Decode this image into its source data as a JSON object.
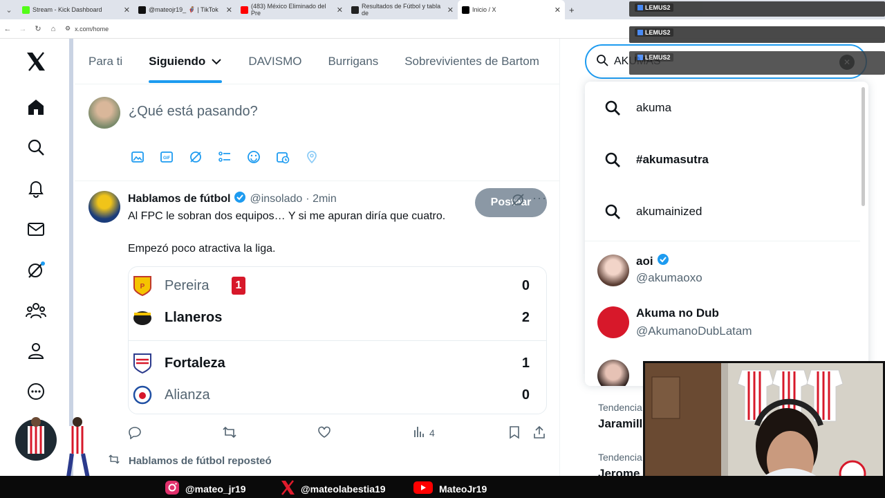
{
  "browser": {
    "tabs": [
      {
        "label": "Stream - Kick Dashboard",
        "color": "#53fc18"
      },
      {
        "label": "@mateojr19_ 🦸 | TikTok",
        "color": "#111111"
      },
      {
        "label": "(483) México Eliminado del Pre",
        "color": "#ff0000"
      },
      {
        "label": "Resultados de Fútbol y tabla de",
        "color": "#222222"
      },
      {
        "label": "Inicio / X",
        "color": "#000000"
      }
    ],
    "url": "x.com/home",
    "new_tab_symbol": "+"
  },
  "overlays": {
    "stream_tags": [
      "LEMUS2",
      "LEMUS2",
      "LEMUS2"
    ]
  },
  "nav": {
    "items": [
      "x-logo",
      "home-icon",
      "search-icon",
      "bell-icon",
      "mail-icon",
      "grok-icon",
      "communities-icon",
      "profile-icon",
      "more-icon"
    ]
  },
  "timeline": {
    "tabs": [
      "Para ti",
      "Siguiendo",
      "DAVISMO",
      "Burrigans",
      "Sobrevivientes de Bartom"
    ],
    "selected_tab": "Siguiendo",
    "compose_placeholder": "¿Qué está pasando?",
    "post_button": "Postear"
  },
  "tweet": {
    "name": "Hablamos de fútbol",
    "handle": "@insolado",
    "time": "· 2min",
    "line1": "Al FPC le sobran dos equipos… Y si me apuran diría que cuatro.",
    "line2": "Empezó poco atractiva la liga.",
    "matches": [
      {
        "home": "Pereira",
        "home_score": "0",
        "home_red_cards": "1",
        "away": "Llaneros",
        "away_score": "2"
      },
      {
        "home": "Fortaleza",
        "home_score": "1",
        "away": "Alianza",
        "away_score": "0"
      }
    ],
    "views": "4"
  },
  "repost": {
    "label": "Hablamos de fútbol reposteó"
  },
  "search": {
    "query": "AKUMAS",
    "suggestions": [
      "akuma",
      "#akumasutra",
      "akumainized"
    ],
    "users": [
      {
        "name": "aoi",
        "handle": "@akumaoxo",
        "verified": true
      },
      {
        "name": "Akuma no Dub",
        "handle": "@AkumanoDubLatam",
        "verified": false
      }
    ],
    "clear_symbol": "✕"
  },
  "trends": {
    "items": [
      {
        "label": "Tendencia",
        "title": "Jaramill"
      },
      {
        "label": "Tendencia",
        "title": "Jerome"
      }
    ]
  },
  "stream_bar": {
    "instagram": "@mateo_jr19",
    "x": "@mateolabestia19",
    "youtube": "MateoJr19"
  },
  "colors": {
    "accent": "#1d9bf0",
    "red_card": "#d7182a",
    "post_disabled": "#8b98a5"
  }
}
